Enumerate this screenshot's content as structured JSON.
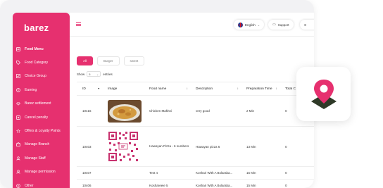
{
  "brand": {
    "name": "barez"
  },
  "sidebar": {
    "items": [
      {
        "label": "Food Menu",
        "icon": "menu-book-icon",
        "active": true
      },
      {
        "label": "Food Category",
        "icon": "tag-icon"
      },
      {
        "label": "Choice Group",
        "icon": "checklist-icon"
      },
      {
        "label": "Earning",
        "icon": "wallet-icon"
      },
      {
        "label": "Barez settlement",
        "icon": "handshake-icon"
      },
      {
        "label": "Cancel penalty",
        "icon": "cancel-icon"
      },
      {
        "label": "Offers & Loyalty Points",
        "icon": "offer-icon"
      },
      {
        "label": "Manage Branch",
        "icon": "branch-icon"
      },
      {
        "label": "Manage Staff",
        "icon": "staff-icon"
      },
      {
        "label": "Manage permission",
        "icon": "permission-icon"
      },
      {
        "label": "Other",
        "icon": "other-icon"
      }
    ]
  },
  "topbar": {
    "language": "English",
    "support": "Support"
  },
  "filters": [
    {
      "label": "All",
      "active": true
    },
    {
      "label": "Burger"
    },
    {
      "label": "sweet"
    }
  ],
  "entries": {
    "show_label": "Show",
    "value": "5",
    "entries_label": "entries"
  },
  "table": {
    "columns": [
      "ID",
      "Image",
      "Food name",
      "Description",
      "Preparation Time",
      "Total C"
    ],
    "rows": [
      {
        "id": "10416",
        "image": "curry-photo",
        "name": "Chicken Makhni",
        "description": "very good",
        "prep": "2 Min",
        "total": "0"
      },
      {
        "id": "10403",
        "image": "qr-code",
        "name": "Hawayan Pizza - 6 numbers",
        "description": "Hawayan pizza 6",
        "prep": "13 Min",
        "total": "0"
      },
      {
        "id": "10407",
        "image": "",
        "name": "Test 4",
        "description": "Koshari With A Bolaraba...",
        "prep": "15 Min",
        "total": "0"
      },
      {
        "id": "10406",
        "image": "",
        "name": "Koshareeie 5",
        "description": "Koshari With A Bolaraba...",
        "prep": "15 Min",
        "total": "0"
      }
    ]
  },
  "colors": {
    "accent": "#e6306f",
    "location_dark": "#2f3a28"
  }
}
